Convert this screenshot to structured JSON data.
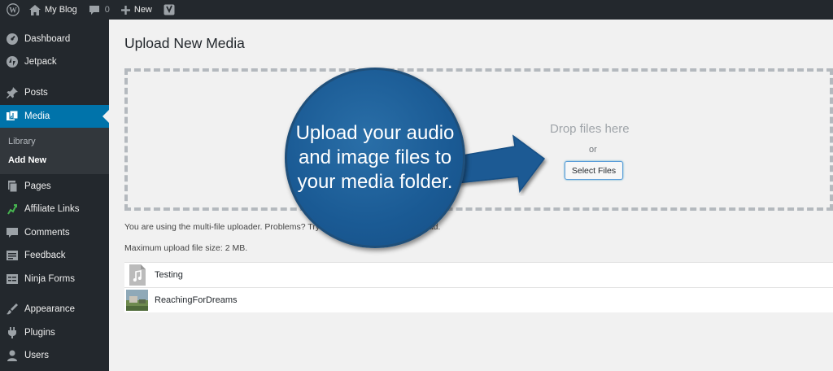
{
  "adminbar": {
    "site_name": "My Blog",
    "comments_count": "0",
    "new_label": "New"
  },
  "sidebar": {
    "items": [
      {
        "label": "Dashboard",
        "icon": "dashboard-icon"
      },
      {
        "label": "Jetpack",
        "icon": "jetpack-icon"
      },
      {
        "label": "Posts",
        "icon": "pushpin-icon"
      },
      {
        "label": "Media",
        "icon": "media-icon"
      },
      {
        "label": "Pages",
        "icon": "pages-icon"
      },
      {
        "label": "Affiliate Links",
        "icon": "affiliate-links-icon"
      },
      {
        "label": "Comments",
        "icon": "comments-icon"
      },
      {
        "label": "Feedback",
        "icon": "feedback-icon"
      },
      {
        "label": "Ninja Forms",
        "icon": "ninja-forms-icon"
      },
      {
        "label": "Appearance",
        "icon": "appearance-icon"
      },
      {
        "label": "Plugins",
        "icon": "plugins-icon"
      },
      {
        "label": "Users",
        "icon": "users-icon"
      }
    ],
    "media_submenu": [
      {
        "label": "Library"
      },
      {
        "label": "Add New"
      }
    ]
  },
  "main": {
    "title": "Upload New Media",
    "drop_text": "Drop files here",
    "or_text": "or",
    "select_button": "Select Files",
    "uploader_note_start": "You are using the multi-file uploader. Problems? Try",
    "uploader_note_end": "tead.",
    "max_size": "Maximum upload file size: 2 MB.",
    "files": [
      {
        "name": "Testing",
        "icon": "audio-file-icon"
      },
      {
        "name": "ReachingForDreams",
        "icon": "image-thumbnail"
      }
    ]
  },
  "callout": {
    "text": "Upload your audio and image files to your media folder."
  },
  "colors": {
    "admin_dark": "#23282d",
    "accent": "#0073aa",
    "callout_blue": "#1a5a94"
  }
}
